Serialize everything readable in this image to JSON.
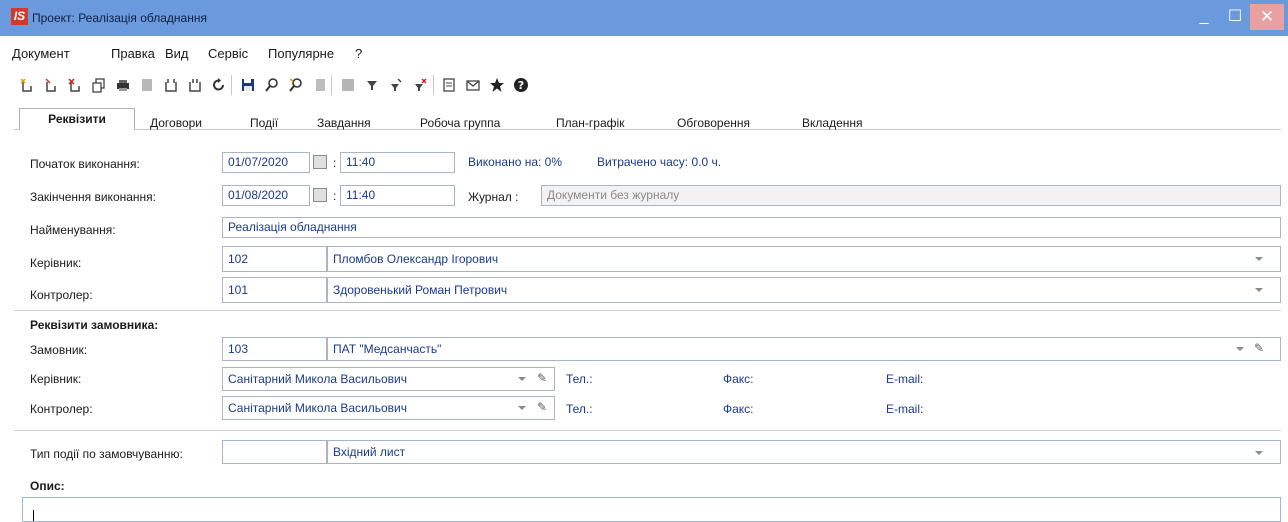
{
  "window": {
    "title": "Проект: Реалізація обладнання",
    "logo_text": "IS",
    "minimize": "_",
    "maximize": "☐",
    "close": "✕"
  },
  "menu": [
    "Документ",
    "Правка",
    "Вид",
    "Сервіс",
    "Популярне",
    "?"
  ],
  "toolbar": [
    "new-icon",
    "new-sub-icon",
    "delete-icon",
    "copy-icon",
    "print-icon",
    "disabled-icon",
    "folder-new-icon",
    "folder-open-icon",
    "refresh-icon",
    "save-icon",
    "search-icon",
    "find-next-icon",
    "disabled2-icon",
    "disabled3-icon",
    "filter-icon",
    "filter-edit-icon",
    "filter-clear-icon",
    "doc-icon",
    "mail-icon",
    "star-icon",
    "help-icon"
  ],
  "tabs": {
    "active": "Реквізити",
    "others": [
      "Договори",
      "Події",
      "Завдання",
      "Робоча группа",
      "План-графік",
      "Обговорення",
      "Вкладення"
    ]
  },
  "form": {
    "start_label": "Початок виконання:",
    "start_date": "01/07/2020",
    "start_time": "11:40",
    "end_label": "Закінчення виконання:",
    "end_date": "01/08/2020",
    "end_time": "11:40",
    "time_colon": ":",
    "done_text": "Виконано на: 0%",
    "spent_text": "Витрачено часу: 0.0 ч.",
    "journal_label": "Журнал :",
    "journal_value": "Документи без журналу",
    "name_label": "Найменування:",
    "name_value": "Реалізація обладнання",
    "manager_label": "Керівник:",
    "manager_code": "102",
    "manager_name": "Пломбов Олександр Ігорович",
    "controller_label": "Контролер:",
    "controller_code": "101",
    "controller_name": "Здоровенький Роман Петрович"
  },
  "customer": {
    "section_title": "Реквізити замовника:",
    "customer_label": "Замовник:",
    "customer_code": "103",
    "customer_name": "ПАТ \"Медсанчасть\"",
    "manager_label": "Керівник:",
    "manager_value": "Санітарний Микола Васильович",
    "controller_label": "Контролер:",
    "controller_value": "Санітарний Микола Васильович",
    "tel_label": "Тел.:",
    "fax_label": "Факс:",
    "email_label": "E-mail:"
  },
  "event": {
    "type_label": "Тип події по замовчуванню:",
    "type_code": "",
    "type_value": "Вхідний лист"
  },
  "description": {
    "label": "Опис:"
  }
}
